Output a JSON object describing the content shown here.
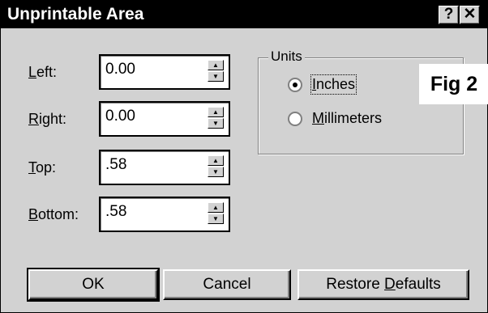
{
  "window": {
    "title": "Unprintable Area",
    "help_label": "?",
    "close_label": "✕"
  },
  "fields": {
    "left": {
      "label_mnemonic": "L",
      "label_rest": "eft:",
      "value": "0.00"
    },
    "right": {
      "label_mnemonic": "R",
      "label_rest": "ight:",
      "value": "0.00"
    },
    "top": {
      "label_mnemonic": "T",
      "label_rest": "op:",
      "value": ".58"
    },
    "bottom": {
      "label_mnemonic": "B",
      "label_rest": "ottom:",
      "value": ".58"
    }
  },
  "units": {
    "legend": "Units",
    "inches": {
      "mnemonic": "I",
      "rest": "nches",
      "selected": true
    },
    "millimeters": {
      "mnemonic": "M",
      "rest": "illimeters",
      "selected": false
    }
  },
  "annotation": "Fig 2",
  "buttons": {
    "ok": "OK",
    "cancel": "Cancel",
    "restore_pre": "Restore ",
    "restore_mnemonic": "D",
    "restore_post": "efaults"
  },
  "icons": {
    "spin_up": "spin-up-arrow-icon",
    "spin_down": "spin-down-arrow-icon"
  }
}
